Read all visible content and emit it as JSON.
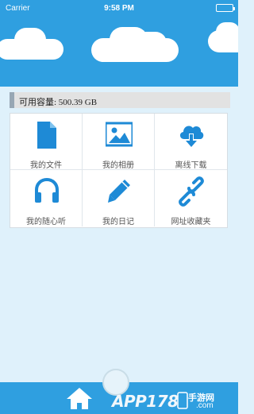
{
  "status_bar": {
    "carrier": "Carrier",
    "time": "9:58 PM"
  },
  "storage": {
    "label": "可用容量: 500.39 GB"
  },
  "grid": {
    "items": [
      {
        "label": "我的文件",
        "icon": "file-icon"
      },
      {
        "label": "我的相册",
        "icon": "photo-icon"
      },
      {
        "label": "离线下载",
        "icon": "cloud-download-icon"
      },
      {
        "label": "我的随心听",
        "icon": "headphones-icon"
      },
      {
        "label": "我的日记",
        "icon": "pencil-icon"
      },
      {
        "label": "网址收藏夹",
        "icon": "link-icon"
      }
    ]
  },
  "watermark": {
    "logo": "APP178",
    "site": "手游网",
    "domain": ".com"
  },
  "colors": {
    "primary": "#2f9fe0",
    "background": "#dff1fb"
  }
}
